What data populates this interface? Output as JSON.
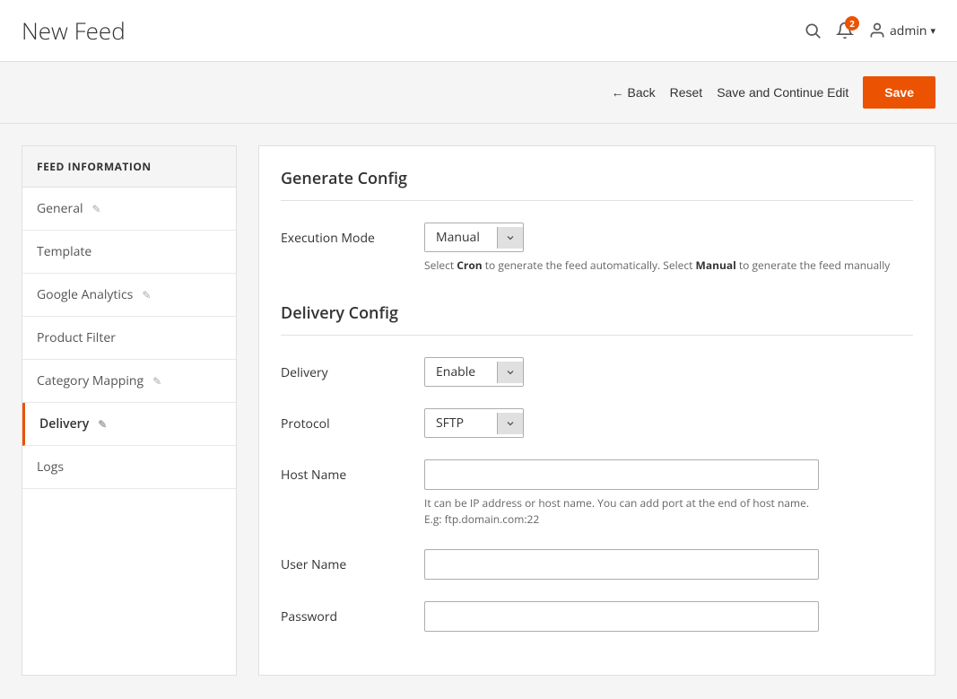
{
  "page": {
    "title": "New Feed"
  },
  "header": {
    "search_label": "Search",
    "notification_count": "2",
    "admin_label": "admin",
    "dropdown_icon": "▾"
  },
  "toolbar": {
    "back_label": "Back",
    "reset_label": "Reset",
    "save_continue_label": "Save and Continue Edit",
    "save_label": "Save"
  },
  "sidebar": {
    "section_title": "FEED INFORMATION",
    "items": [
      {
        "id": "general",
        "label": "General",
        "has_edit": true,
        "active": false
      },
      {
        "id": "template",
        "label": "Template",
        "has_edit": false,
        "active": false
      },
      {
        "id": "google-analytics",
        "label": "Google Analytics",
        "has_edit": true,
        "active": false
      },
      {
        "id": "product-filter",
        "label": "Product Filter",
        "has_edit": false,
        "active": false
      },
      {
        "id": "category-mapping",
        "label": "Category Mapping",
        "has_edit": true,
        "active": false
      },
      {
        "id": "delivery",
        "label": "Delivery",
        "has_edit": true,
        "active": true
      },
      {
        "id": "logs",
        "label": "Logs",
        "has_edit": false,
        "active": false
      }
    ]
  },
  "generate_config": {
    "section_title": "Generate Config",
    "execution_mode": {
      "label": "Execution Mode",
      "value": "Manual",
      "hint_prefix": "Select ",
      "hint_cron": "Cron",
      "hint_middle": " to generate the feed automatically. Select ",
      "hint_manual": "Manual",
      "hint_suffix": " to generate the feed manually"
    }
  },
  "delivery_config": {
    "section_title": "Delivery Config",
    "delivery": {
      "label": "Delivery",
      "value": "Enable"
    },
    "protocol": {
      "label": "Protocol",
      "value": "SFTP"
    },
    "host_name": {
      "label": "Host Name",
      "placeholder": "",
      "hint_line1": "It can be IP address or host name. You can add port at the end of host name.",
      "hint_line2": "E.g: ftp.domain.com:22"
    },
    "user_name": {
      "label": "User Name",
      "placeholder": ""
    },
    "password": {
      "label": "Password",
      "placeholder": ""
    }
  }
}
